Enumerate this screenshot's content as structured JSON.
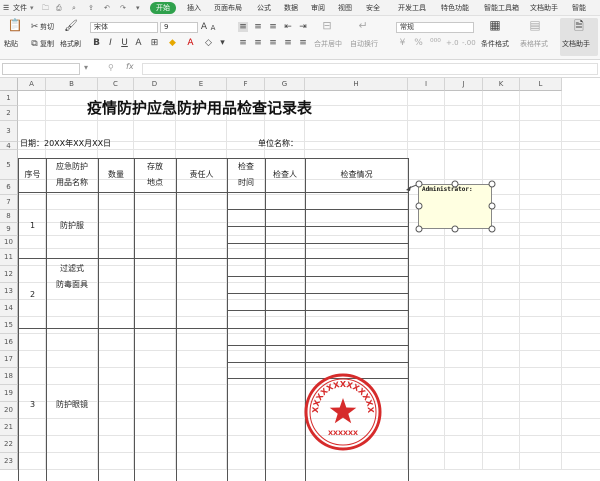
{
  "menu": {
    "items": [
      "文件",
      "开始",
      "插入",
      "页面布局",
      "公式",
      "数据",
      "审阅",
      "视图",
      "安全",
      "开发工具",
      "特色功能",
      "智能工具箱",
      "文档助手",
      "智能"
    ],
    "active": "开始"
  },
  "ribbon": {
    "cut": "剪切",
    "copy": "复制",
    "paste": "粘贴",
    "format_painter": "格式刷",
    "font_name": "宋体",
    "font_size": "9",
    "merge_center": "合并居中",
    "auto_wrap": "自动换行",
    "number_format": "常规",
    "conditional_format": "条件格式",
    "table_style": "表格样式",
    "doc_helper": "文档助手"
  },
  "formula": {
    "fx": "fx",
    "name_box": ""
  },
  "columns": [
    "A",
    "B",
    "C",
    "D",
    "E",
    "F",
    "G",
    "H",
    "I",
    "J",
    "K",
    "L"
  ],
  "rows": [
    "1",
    "2",
    "3",
    "4",
    "5",
    "6",
    "7",
    "8",
    "9",
    "10",
    "11",
    "12",
    "13",
    "14",
    "15",
    "16",
    "17",
    "18",
    "19",
    "20",
    "21",
    "22",
    "23"
  ],
  "sheet": {
    "title": "疫情防护应急防护用品检查记录表",
    "date_label": "日期：20XX年XX月XX日",
    "unit_label": "单位名称：",
    "headers": {
      "seq": "序号",
      "name_l1": "应急防护",
      "name_l2": "用品名称",
      "qty": "数量",
      "loc_l1": "存放",
      "loc_l2": "地点",
      "owner": "责任人",
      "time_l1": "检查",
      "time_l2": "时间",
      "inspector": "检查人",
      "status": "检查情况"
    },
    "items": [
      {
        "seq": "1",
        "name_l1": "防护服",
        "name_l2": ""
      },
      {
        "seq": "2",
        "name_l1": "过滤式",
        "name_l2": "防毒面具"
      },
      {
        "seq": "3",
        "name_l1": "防护眼镜",
        "name_l2": ""
      }
    ]
  },
  "comment": {
    "author": "Administrator:"
  },
  "stamp": {
    "top_text": "XXXXXXXXXXXXX",
    "bottom_text": "XXXXXX"
  },
  "colors": {
    "accent": "#2fa14c",
    "stamp": "#d62b2b",
    "comment_bg": "#ffffe1"
  }
}
